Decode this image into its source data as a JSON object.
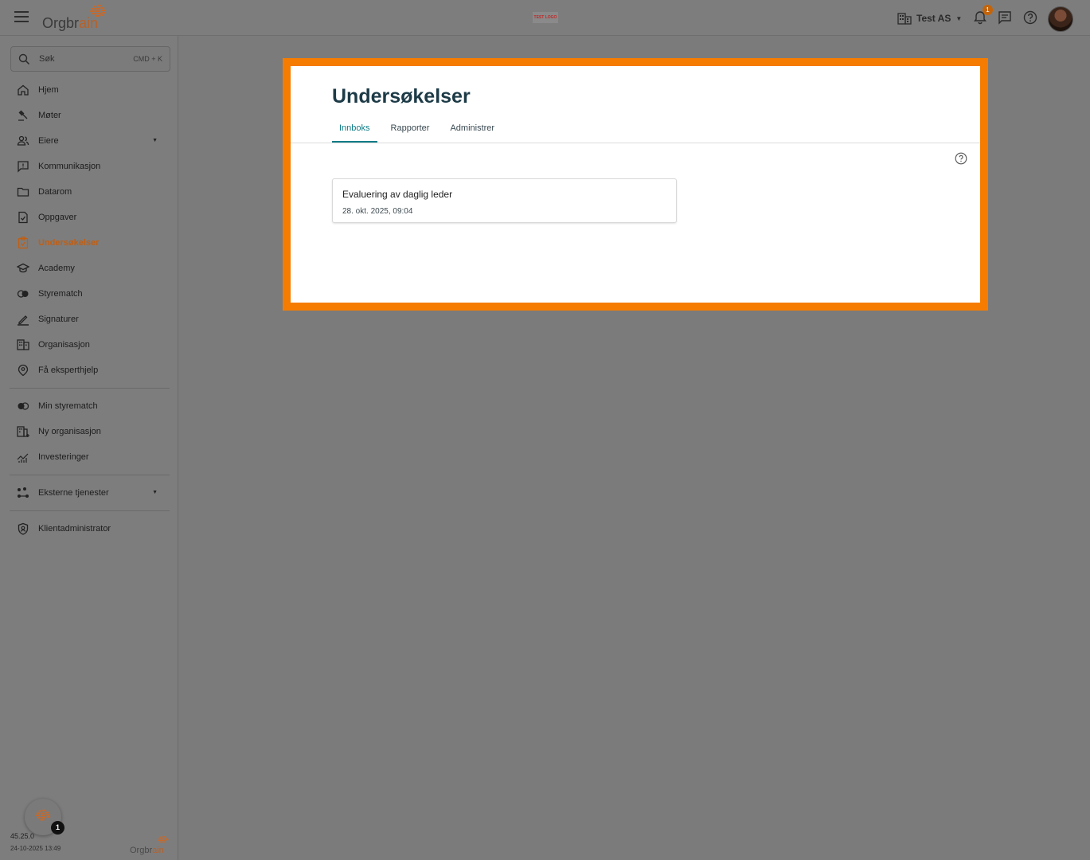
{
  "topbar": {
    "logo_text_main": "Orgbr",
    "logo_text_accent": "ain",
    "test_logo": "TEST LOGO",
    "org_name": "Test AS",
    "notification_count": "1"
  },
  "search": {
    "placeholder": "Søk",
    "shortcut": "CMD + K"
  },
  "sidebar": {
    "items": [
      {
        "label": "Hjem",
        "icon": "home-icon"
      },
      {
        "label": "Møter",
        "icon": "gavel-icon"
      },
      {
        "label": "Eiere",
        "icon": "people-icon"
      },
      {
        "label": "Kommunikasjon",
        "icon": "message-icon"
      },
      {
        "label": "Datarom",
        "icon": "folder-icon"
      },
      {
        "label": "Oppgaver",
        "icon": "task-icon"
      },
      {
        "label": "Undersøkelser",
        "icon": "survey-icon"
      },
      {
        "label": "Academy",
        "icon": "graduation-cap-icon"
      },
      {
        "label": "Styrematch",
        "icon": "match-icon"
      },
      {
        "label": "Signaturer",
        "icon": "pen-icon"
      },
      {
        "label": "Organisasjon",
        "icon": "building-icon"
      },
      {
        "label": "Få eksperthjelp",
        "icon": "expert-icon"
      }
    ],
    "secondary": [
      {
        "label": "Min styrematch",
        "icon": "toggle-icon"
      },
      {
        "label": "Ny organisasjon",
        "icon": "add-building-icon"
      },
      {
        "label": "Investeringer",
        "icon": "chart-icon"
      }
    ],
    "external": {
      "label": "Eksterne tjenester",
      "icon": "services-icon"
    },
    "admin": {
      "label": "Klientadministrator",
      "icon": "shield-icon"
    },
    "active": "Undersøkelser"
  },
  "footer": {
    "chat_badge": "1",
    "version": "45.25.0",
    "date": "24-10-2025 13:49",
    "logo_main": "Orgbr",
    "logo_accent": "ain"
  },
  "main": {
    "title": "Undersøkelser",
    "tabs": [
      {
        "label": "Innboks",
        "active": true
      },
      {
        "label": "Rapporter",
        "active": false
      },
      {
        "label": "Administrer",
        "active": false
      }
    ],
    "cards": [
      {
        "title": "Evaluering av daglig leder",
        "date": "28. okt. 2025, 09:04"
      }
    ]
  },
  "colors": {
    "highlight": "#f57c00",
    "accent": "#0e7c86",
    "active_nav": "#c25e12",
    "title": "#1d3b47"
  }
}
